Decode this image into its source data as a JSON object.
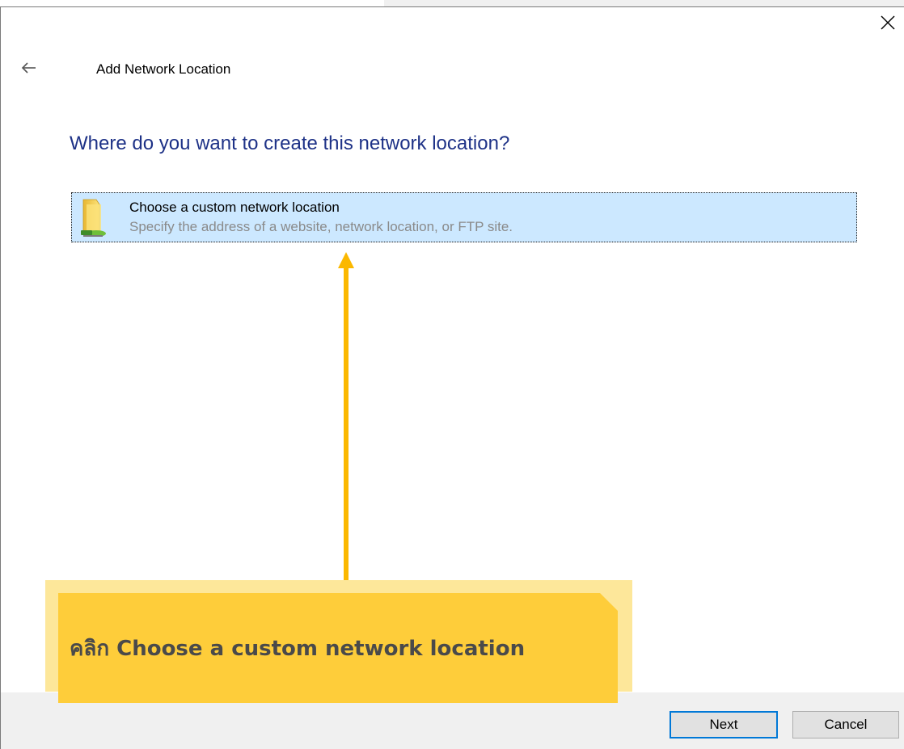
{
  "window": {
    "title": "Add Network Location",
    "close_icon": "close-icon",
    "back_icon": "back-arrow-icon"
  },
  "main": {
    "heading": "Where do you want to create this network location?",
    "option": {
      "title": "Choose a custom network location",
      "description": "Specify the address of a website, network location, or FTP site.",
      "icon": "network-folder-icon",
      "selected": true
    }
  },
  "footer": {
    "next_label": "Next",
    "cancel_label": "Cancel"
  },
  "annotation": {
    "text": "คลิก Choose a custom network location",
    "arrow_icon": "arrow-up-icon"
  },
  "colors": {
    "heading": "#1e3287",
    "selection_bg": "#cce8ff",
    "accent": "#0078d7",
    "callout": "#fecd3a",
    "callout_shadow": "#fde79a",
    "arrow": "#fbb800"
  }
}
